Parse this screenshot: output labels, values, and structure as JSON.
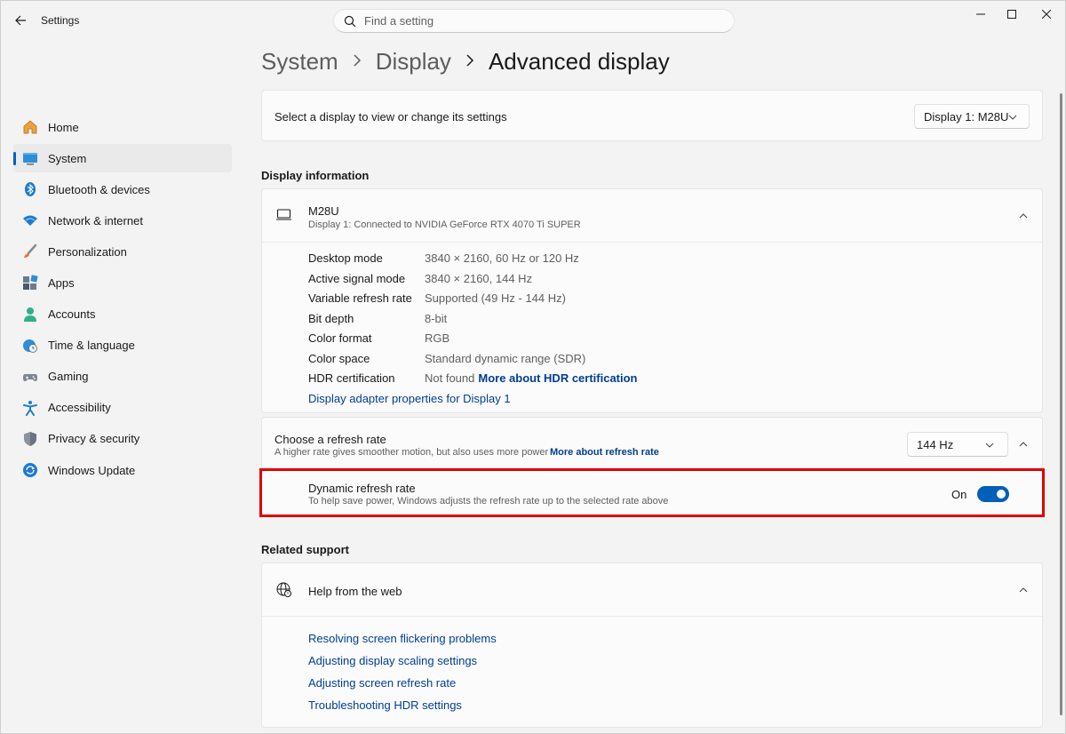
{
  "window": {
    "app_title": "Settings",
    "search_placeholder": "Find a setting"
  },
  "sidebar": {
    "items": [
      {
        "label": "Home",
        "icon": "home-icon"
      },
      {
        "label": "System",
        "icon": "system-icon",
        "active": true
      },
      {
        "label": "Bluetooth & devices",
        "icon": "bluetooth-icon"
      },
      {
        "label": "Network & internet",
        "icon": "wifi-icon"
      },
      {
        "label": "Personalization",
        "icon": "brush-icon"
      },
      {
        "label": "Apps",
        "icon": "apps-icon"
      },
      {
        "label": "Accounts",
        "icon": "person-icon"
      },
      {
        "label": "Time & language",
        "icon": "globe-clock-icon"
      },
      {
        "label": "Gaming",
        "icon": "gamepad-icon"
      },
      {
        "label": "Accessibility",
        "icon": "accessibility-icon"
      },
      {
        "label": "Privacy & security",
        "icon": "shield-icon"
      },
      {
        "label": "Windows Update",
        "icon": "update-icon"
      }
    ]
  },
  "breadcrumb": {
    "level1": "System",
    "level2": "Display",
    "current": "Advanced display"
  },
  "display_select": {
    "label": "Select a display to view or change its settings",
    "value": "Display 1: M28U"
  },
  "display_info": {
    "section_title": "Display information",
    "monitor_name": "M28U",
    "monitor_subtitle": "Display 1: Connected to NVIDIA GeForce RTX 4070 Ti SUPER",
    "rows": [
      {
        "label": "Desktop mode",
        "value": "3840 × 2160, 60 Hz or 120 Hz"
      },
      {
        "label": "Active signal mode",
        "value": "3840 × 2160, 144 Hz"
      },
      {
        "label": "Variable refresh rate",
        "value": "Supported (49 Hz - 144 Hz)"
      },
      {
        "label": "Bit depth",
        "value": "8-bit"
      },
      {
        "label": "Color format",
        "value": "RGB"
      },
      {
        "label": "Color space",
        "value": "Standard dynamic range (SDR)"
      },
      {
        "label": "HDR certification",
        "value": "Not found",
        "link": "More about HDR certification"
      }
    ],
    "adapter_link": "Display adapter properties for Display 1"
  },
  "refresh_rate": {
    "title": "Choose a refresh rate",
    "subtitle": "A higher rate gives smoother motion, but also uses more power",
    "link": "More about refresh rate",
    "value": "144 Hz"
  },
  "dynamic_refresh": {
    "title": "Dynamic refresh rate",
    "subtitle": "To help save power, Windows adjusts the refresh rate up to the selected rate above",
    "state_label": "On",
    "enabled": true
  },
  "related_support": {
    "section_title": "Related support",
    "help_title": "Help from the web",
    "links": [
      "Resolving screen flickering problems",
      "Adjusting display scaling settings",
      "Adjusting screen refresh rate",
      "Troubleshooting HDR settings"
    ]
  },
  "colors": {
    "accent": "#005fb8",
    "link": "#003e92",
    "highlight": "#e00000"
  }
}
